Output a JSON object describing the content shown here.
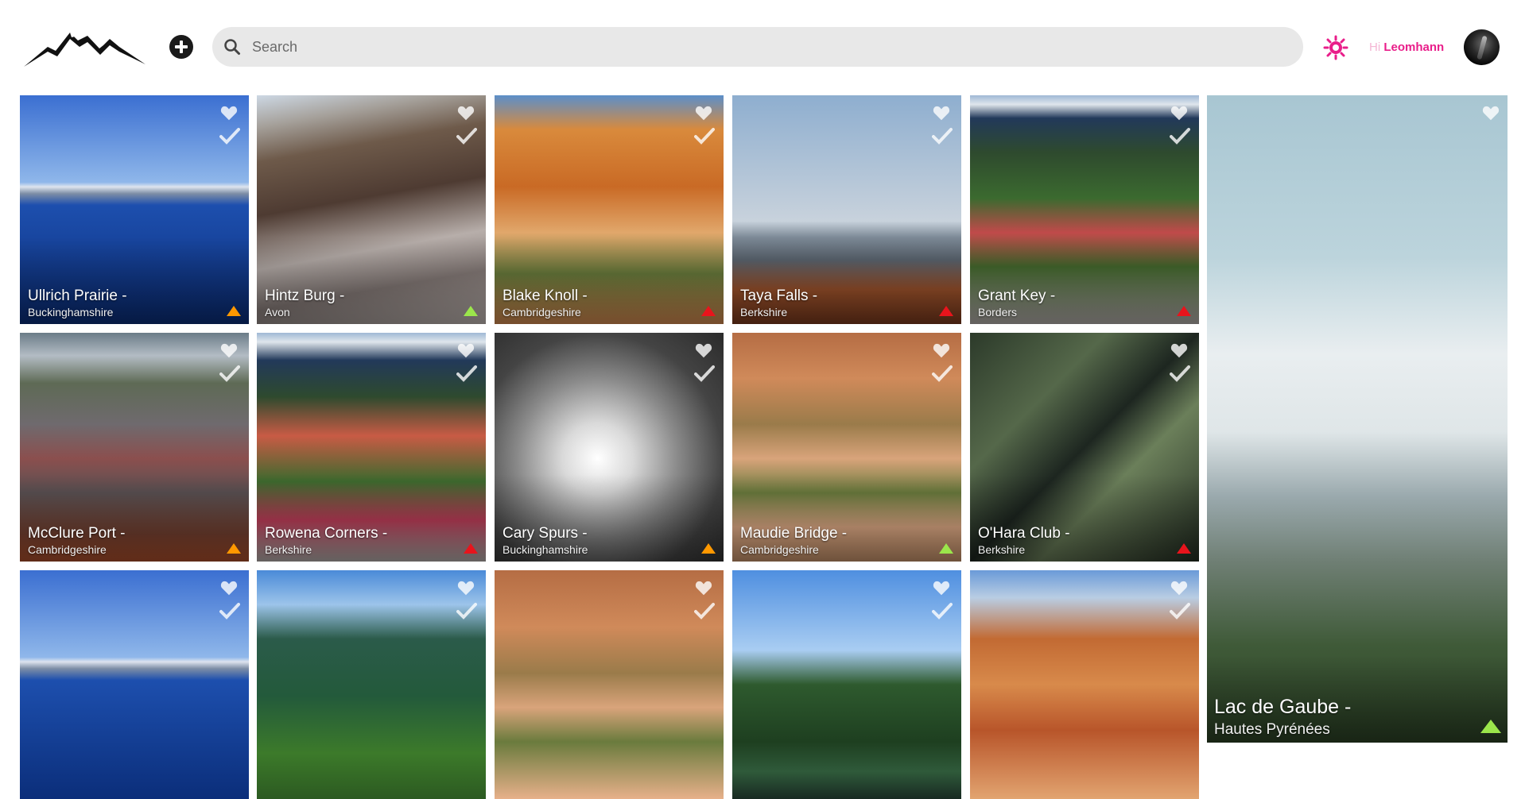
{
  "header": {
    "search_placeholder": "Search",
    "greeting_prefix": "Hi",
    "username": "Leomhann",
    "accent_color": "#e91e8a",
    "icons": [
      "mountain-logo",
      "add-icon",
      "search-icon",
      "theme-sun-icon",
      "avatar"
    ]
  },
  "difficulty_colors": {
    "easy": "#9be64b",
    "medium": "#ff9800",
    "hard": "#e8141c"
  },
  "cards": [
    {
      "title": "Ullrich Prairie -",
      "region": "Buckinghamshire",
      "difficulty": "medium"
    },
    {
      "title": "Hintz Burg -",
      "region": "Avon",
      "difficulty": "easy"
    },
    {
      "title": "Blake Knoll -",
      "region": "Cambridgeshire",
      "difficulty": "hard"
    },
    {
      "title": "Taya Falls -",
      "region": "Berkshire",
      "difficulty": "hard"
    },
    {
      "title": "Grant Key -",
      "region": "Borders",
      "difficulty": "hard"
    },
    {
      "title": "McClure Port -",
      "region": "Cambridgeshire",
      "difficulty": "medium"
    },
    {
      "title": "Rowena Corners -",
      "region": "Berkshire",
      "difficulty": "hard"
    },
    {
      "title": "Cary Spurs -",
      "region": "Buckinghamshire",
      "difficulty": "medium"
    },
    {
      "title": "Maudie Bridge -",
      "region": "Cambridgeshire",
      "difficulty": "easy"
    },
    {
      "title": "O'Hara Club -",
      "region": "Berkshire",
      "difficulty": "hard"
    },
    {
      "title": "",
      "region": "",
      "difficulty": ""
    },
    {
      "title": "",
      "region": "",
      "difficulty": ""
    },
    {
      "title": "",
      "region": "",
      "difficulty": ""
    },
    {
      "title": "",
      "region": "",
      "difficulty": ""
    },
    {
      "title": "",
      "region": "",
      "difficulty": ""
    }
  ],
  "featured": {
    "title": "Lac de Gaube -",
    "region": "Hautes Pyrénées",
    "difficulty": "easy"
  }
}
